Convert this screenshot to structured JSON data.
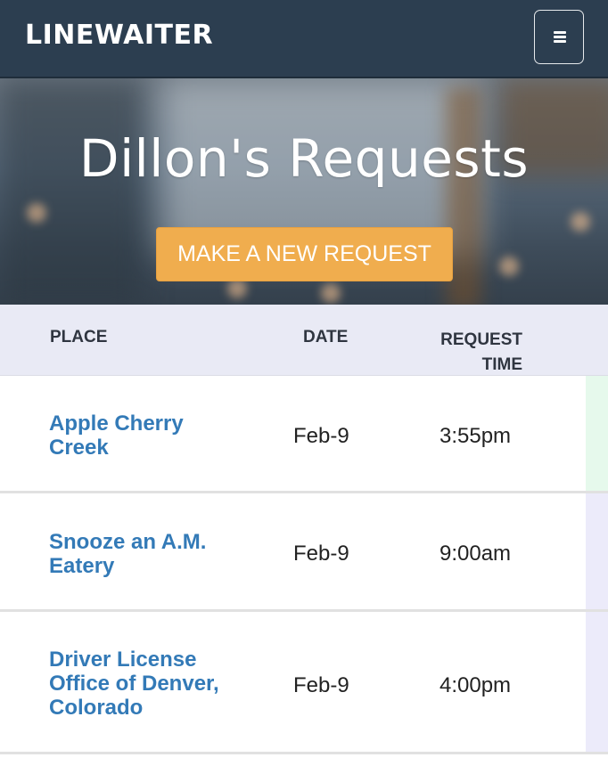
{
  "navbar": {
    "brand": "LINEWAITER",
    "menu_icon": "hamburger-menu-icon"
  },
  "hero": {
    "title": "Dillon's Requests",
    "button_label": "MAKE A NEW REQUEST",
    "button_color": "#f0ad4e"
  },
  "table": {
    "headers": {
      "place": "PLACE",
      "date": "DATE",
      "time_line1": "REQUEST",
      "time_line2": "TIME"
    },
    "rows": [
      {
        "place": "Apple Cherry Creek",
        "date": "Feb-9",
        "time": "3:55pm",
        "accent_color": "#e6f9ec"
      },
      {
        "place": "Snooze an A.M. Eatery",
        "date": "Feb-9",
        "time": "9:00am",
        "accent_color": "#ecebfa"
      },
      {
        "place": "Driver License Office of Denver, Colorado",
        "date": "Feb-9",
        "time": "4:00pm",
        "accent_color": "#ecebfa"
      }
    ]
  },
  "colors": {
    "navbar_bg": "#2c3e50",
    "link": "#337ab7",
    "header_bg": "#e9eaf5"
  }
}
